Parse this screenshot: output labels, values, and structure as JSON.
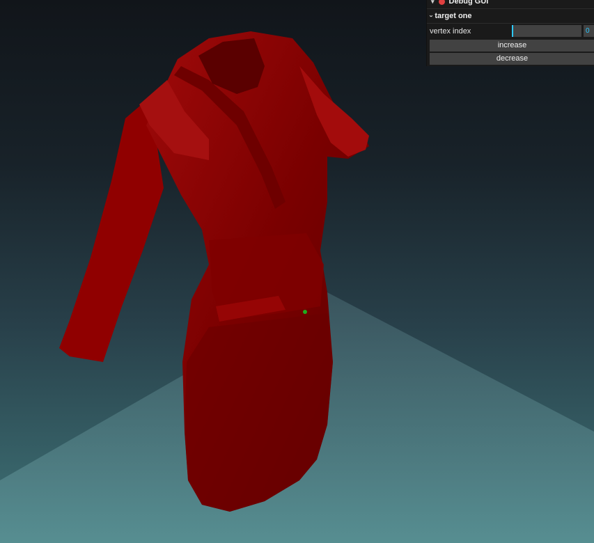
{
  "gui": {
    "title": "Debug GUI",
    "folder": {
      "title": "target one",
      "controls": {
        "vertex_index_label": "vertex index",
        "vertex_index_value": "0",
        "increase_label": "increase",
        "decrease_label": "decrease"
      }
    }
  },
  "scene": {
    "background_top": "#11151a",
    "background_bottom": "#3f7478",
    "model_color": "#8b0000",
    "marker_color": "#1fae1f"
  }
}
